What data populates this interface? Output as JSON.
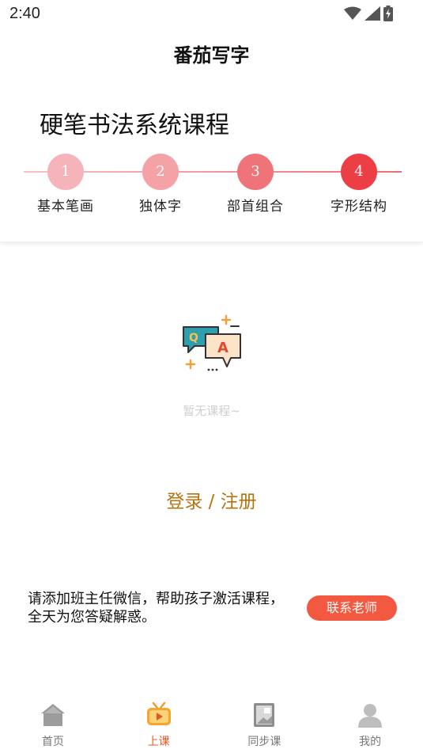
{
  "status_bar": {
    "time": "2:40"
  },
  "app": {
    "title": "番茄写字"
  },
  "course": {
    "title": "硬笔书法系统课程",
    "steps": [
      {
        "number": "1",
        "label": "基本笔画",
        "color": "#f5b4b9"
      },
      {
        "number": "2",
        "label": "独体字",
        "color": "#f4a2a5"
      },
      {
        "number": "3",
        "label": "部首组合",
        "color": "#ef7479"
      },
      {
        "number": "4",
        "label": "字形结构",
        "color": "#ed3e46"
      }
    ]
  },
  "empty_state": {
    "text": "暂无课程~"
  },
  "login": {
    "label": "登录 / 注册"
  },
  "tip": {
    "text": "请添加班主任微信，帮助孩子激活课程，全天为您答疑解惑。"
  },
  "contact_button": {
    "label": "联系老师",
    "color": "#f35840"
  },
  "tabs": [
    {
      "label": "首页",
      "icon": "home-icon"
    },
    {
      "label": "上课",
      "icon": "tv-icon",
      "active": true
    },
    {
      "label": "同步课",
      "icon": "book-icon"
    },
    {
      "label": "我的",
      "icon": "user-icon"
    }
  ]
}
